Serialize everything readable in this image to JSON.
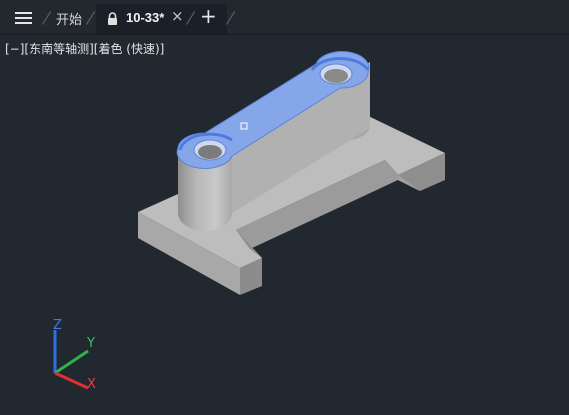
{
  "tabs": {
    "start_label": "开始",
    "active_label": "10-33*",
    "close_glyph": "×",
    "new_tab_glyph": "+"
  },
  "viewport_controls": {
    "view_menu": "[−]",
    "view_direction": "[东南等轴测]",
    "visual_style": "[着色 (快速)]"
  },
  "ucs": {
    "x_label": "X",
    "y_label": "Y",
    "z_label": "Z"
  },
  "colors": {
    "background": "#212830",
    "selection": "#6f95e6",
    "model_gray": "#b4b4b4"
  }
}
